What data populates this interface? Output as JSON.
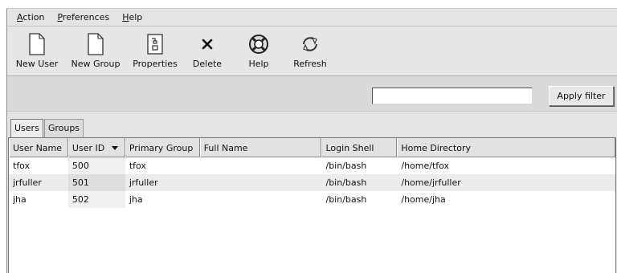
{
  "menu": [
    {
      "underline": "A",
      "rest": "ction"
    },
    {
      "underline": "P",
      "rest": "references"
    },
    {
      "underline": "H",
      "rest": "elp"
    }
  ],
  "toolbar": {
    "new_user": {
      "label": "New User",
      "icon": "new-document-icon"
    },
    "new_group": {
      "label": "New Group",
      "icon": "new-document-icon"
    },
    "properties": {
      "label": "Properties",
      "icon": "properties-icon"
    },
    "delete": {
      "label": "Delete",
      "icon": "delete-x-icon"
    },
    "help": {
      "label": "Help",
      "icon": "lifebuoy-icon"
    },
    "refresh": {
      "label": "Refresh",
      "icon": "refresh-icon"
    }
  },
  "filter": {
    "value": "",
    "apply_label": "Apply filter"
  },
  "tabs": [
    "Users",
    "Groups"
  ],
  "active_tab": "Users",
  "table": {
    "columns": [
      "User Name",
      "User ID",
      "Primary Group",
      "Full Name",
      "Login Shell",
      "Home Directory"
    ],
    "sorted_column": "User ID",
    "rows": [
      [
        "tfox",
        "500",
        "tfox",
        "",
        "/bin/bash",
        "/home/tfox"
      ],
      [
        "jrfuller",
        "501",
        "jrfuller",
        "",
        "/bin/bash",
        "/home/jrfuller"
      ],
      [
        "jha",
        "502",
        "jha",
        "",
        "/bin/bash",
        "/home/jha"
      ]
    ]
  }
}
